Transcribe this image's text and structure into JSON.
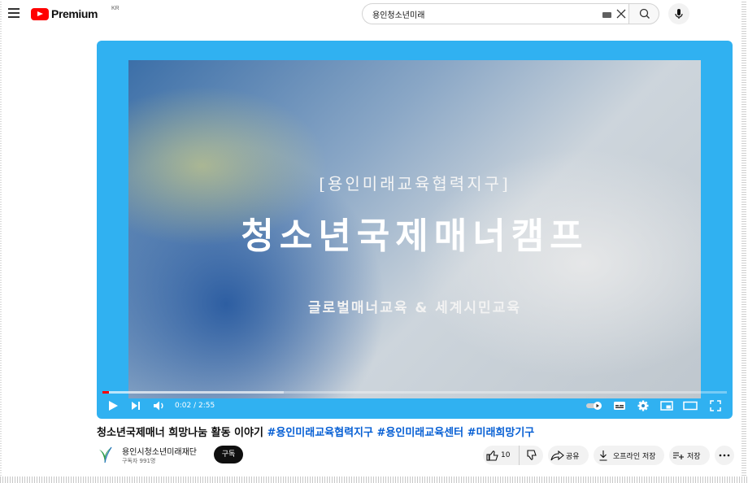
{
  "header": {
    "logo_text": "Premium",
    "logo_region": "KR",
    "search_value": "용인청소년미래"
  },
  "video": {
    "overlay_subtitle": "[용인미래교육협력지구]",
    "overlay_title": "청소년국제매너캠프",
    "overlay_tagline": "글로벌매너교육 & 세계시민교육",
    "time_display": "0:02 / 2:55",
    "progress_fraction": 0.011,
    "buffered_fraction": 0.29
  },
  "title": {
    "text": "청소년국제매너 희망나눔 활동 이야기 ",
    "hashtags": [
      "#용인미래교육협력지구",
      "#용인미래교육센터",
      "#미래희망기구"
    ]
  },
  "channel": {
    "name": "용인시청소년미래재단",
    "subscribers": "구독자 991명",
    "subscribe_label": "구독"
  },
  "actions": {
    "like_count": "10",
    "share_label": "공유",
    "offline_label": "오프라인 저장",
    "save_label": "저장"
  },
  "colors": {
    "player_border": "#30b1f1",
    "brand_red": "#ff0000",
    "hashtag": "#065fd4"
  }
}
